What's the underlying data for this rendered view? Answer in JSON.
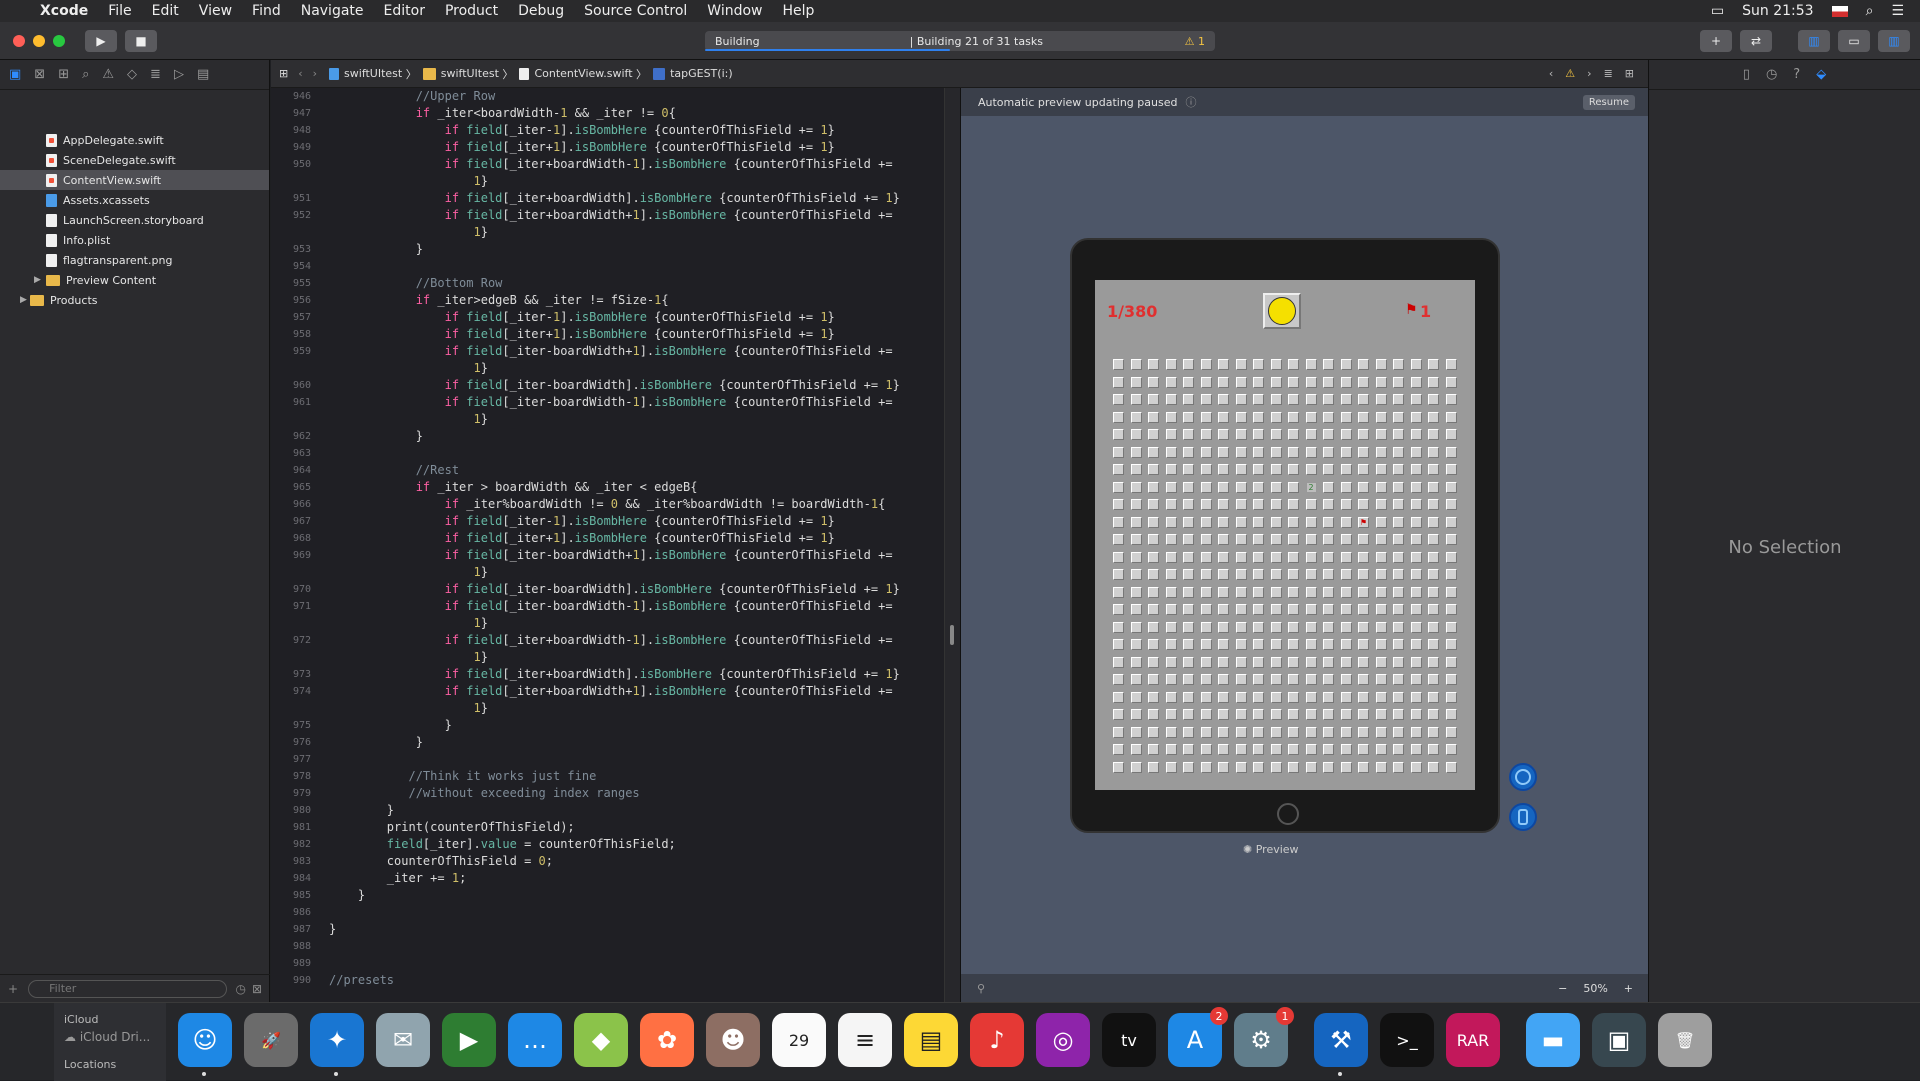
{
  "menubar": {
    "app": "Xcode",
    "items": [
      "File",
      "Edit",
      "View",
      "Find",
      "Navigate",
      "Editor",
      "Product",
      "Debug",
      "Source Control",
      "Window",
      "Help"
    ],
    "clock": "Sun 21:53"
  },
  "toolbar": {
    "activity_left": "Building",
    "activity_right": "| Building 21 of 31 tasks",
    "warning_count": "1",
    "progress": 0.48
  },
  "navigator": {
    "files": [
      {
        "name": "AppDelegate.swift",
        "type": "swift"
      },
      {
        "name": "SceneDelegate.swift",
        "type": "swift"
      },
      {
        "name": "ContentView.swift",
        "type": "swift",
        "selected": true
      },
      {
        "name": "Assets.xcassets",
        "type": "asset"
      },
      {
        "name": "LaunchScreen.storyboard",
        "type": "file"
      },
      {
        "name": "Info.plist",
        "type": "file"
      },
      {
        "name": "flagtransparent.png",
        "type": "file"
      },
      {
        "name": "Preview Content",
        "type": "folder"
      },
      {
        "name": "Products",
        "type": "folder"
      }
    ],
    "filter_placeholder": "Filter"
  },
  "jumpbar": {
    "crumbs": [
      "swiftUItest",
      "swiftUItest",
      "ContentView.swift",
      "tapGEST(i:)"
    ]
  },
  "editor": {
    "first_line": 946,
    "lines": [
      "            //Upper Row",
      "            if _iter<boardWidth-1 && _iter != 0{",
      "                if field[_iter-1].isBombHere {counterOfThisField += 1}",
      "                if field[_iter+1].isBombHere {counterOfThisField += 1}",
      "                if field[_iter+boardWidth-1].isBombHere {counterOfThisField +=",
      "                    1}",
      "                if field[_iter+boardWidth].isBombHere {counterOfThisField += 1}",
      "                if field[_iter+boardWidth+1].isBombHere {counterOfThisField +=",
      "                    1}",
      "            }",
      "",
      "            //Bottom Row",
      "            if _iter>edgeB && _iter != fSize-1{",
      "                if field[_iter-1].isBombHere {counterOfThisField += 1}",
      "                if field[_iter+1].isBombHere {counterOfThisField += 1}",
      "                if field[_iter-boardWidth+1].isBombHere {counterOfThisField +=",
      "                    1}",
      "                if field[_iter-boardWidth].isBombHere {counterOfThisField += 1}",
      "                if field[_iter-boardWidth-1].isBombHere {counterOfThisField +=",
      "                    1}",
      "            }",
      "",
      "            //Rest",
      "            if _iter > boardWidth && _iter < edgeB{",
      "                if _iter%boardWidth != 0 && _iter%boardWidth != boardWidth-1{",
      "                if field[_iter-1].isBombHere {counterOfThisField += 1}",
      "                if field[_iter+1].isBombHere {counterOfThisField += 1}",
      "                if field[_iter-boardWidth+1].isBombHere {counterOfThisField +=",
      "                    1}",
      "                if field[_iter-boardWidth].isBombHere {counterOfThisField += 1}",
      "                if field[_iter-boardWidth-1].isBombHere {counterOfThisField +=",
      "                    1}",
      "                if field[_iter+boardWidth-1].isBombHere {counterOfThisField +=",
      "                    1}",
      "                if field[_iter+boardWidth].isBombHere {counterOfThisField += 1}",
      "                if field[_iter+boardWidth+1].isBombHere {counterOfThisField +=",
      "                    1}",
      "                }",
      "            }",
      "",
      "           //Think it works just fine",
      "           //without exceeding index ranges",
      "        }",
      "        print(counterOfThisField);",
      "        field[_iter].value = counterOfThisField;",
      "        counterOfThisField = 0;",
      "        _iter += 1;",
      "    }",
      "",
      "}",
      "",
      "",
      "//presets"
    ],
    "gutter": [
      "946",
      "947",
      "948",
      "949",
      "950",
      "",
      "951",
      "952",
      "",
      "953",
      "954",
      "955",
      "956",
      "957",
      "958",
      "959",
      "",
      "960",
      "961",
      "",
      "962",
      "963",
      "964",
      "965",
      "966",
      "967",
      "968",
      "969",
      "",
      "970",
      "971",
      "",
      "972",
      "",
      "973",
      "974",
      "",
      "975",
      "976",
      "977",
      "978",
      "979",
      "980",
      "981",
      "982",
      "983",
      "984",
      "985",
      "986",
      "987",
      "988",
      "989",
      "990"
    ]
  },
  "canvas": {
    "pause_text": "Automatic preview updating paused",
    "resume_label": "Resume",
    "preview_label": "Preview",
    "zoom": "50%",
    "game": {
      "counter": "1/380",
      "flags": "1",
      "cols": 20,
      "rows": 24,
      "revealed": [
        {
          "row": 7,
          "col": 11,
          "value": "2"
        }
      ],
      "flagged": [
        {
          "row": 9,
          "col": 14
        }
      ]
    }
  },
  "inspector": {
    "empty_text": "No Selection"
  },
  "dock": {
    "left_labels": [
      "iCloud",
      "iCloud Dri...",
      "Locations"
    ],
    "apps": [
      {
        "name": "finder-icon",
        "color": "#1e88e5",
        "glyph": "☺",
        "dot": true
      },
      {
        "name": "launchpad-icon",
        "color": "#6b6b6b",
        "glyph": "🚀"
      },
      {
        "name": "safari-icon",
        "color": "#1976d2",
        "glyph": "✦",
        "dot": true
      },
      {
        "name": "mail-icon",
        "color": "#90a4ae",
        "glyph": "✉"
      },
      {
        "name": "facetime-icon",
        "color": "#2e7d32",
        "glyph": "▶"
      },
      {
        "name": "messages-icon",
        "color": "#1e88e5",
        "glyph": "…"
      },
      {
        "name": "maps-icon",
        "color": "#8bc34a",
        "glyph": "◆"
      },
      {
        "name": "photos-icon",
        "color": "#ff7043",
        "glyph": "✿"
      },
      {
        "name": "contacts-icon",
        "color": "#8d6e63",
        "glyph": "☻"
      },
      {
        "name": "calendar-icon",
        "color": "#fafafa",
        "glyph": "29",
        "dark": true
      },
      {
        "name": "reminders-icon",
        "color": "#f5f5f5",
        "glyph": "≡",
        "dark": true
      },
      {
        "name": "notes-icon",
        "color": "#fdd835",
        "glyph": "▤",
        "dark": true
      },
      {
        "name": "music-icon",
        "color": "#e53935",
        "glyph": "♪"
      },
      {
        "name": "podcasts-icon",
        "color": "#8e24aa",
        "glyph": "◎"
      },
      {
        "name": "tv-icon",
        "color": "#111111",
        "glyph": "tv"
      },
      {
        "name": "appstore-icon",
        "color": "#1e88e5",
        "glyph": "A",
        "badge": "2"
      },
      {
        "name": "system-preferences-icon",
        "color": "#607d8b",
        "glyph": "⚙",
        "badge": "1"
      },
      {
        "name": "xcode-icon",
        "color": "#1565c0",
        "glyph": "⚒",
        "dot": true
      },
      {
        "name": "terminal-icon",
        "color": "#111111",
        "glyph": ">_"
      },
      {
        "name": "rar-icon",
        "color": "#c2185b",
        "glyph": "RAR"
      },
      {
        "name": "folder-icon",
        "color": "#42a5f5",
        "glyph": "▬"
      },
      {
        "name": "screenshot-icon",
        "color": "#37474f",
        "glyph": "▣"
      },
      {
        "name": "trash-icon",
        "color": "#9e9e9e",
        "glyph": "🗑"
      }
    ]
  }
}
